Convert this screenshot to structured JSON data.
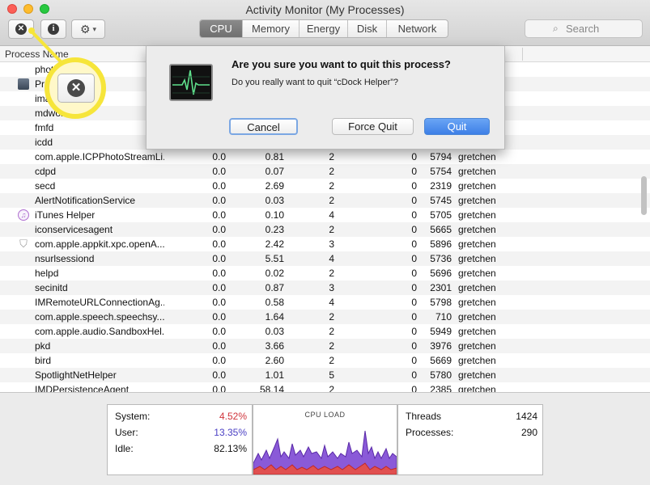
{
  "window": {
    "title": "Activity Monitor (My Processes)"
  },
  "toolbar": {
    "quit_icon": "x-circle-icon",
    "info_icon": "info-icon",
    "gear_icon": "gear-icon",
    "tabs": [
      {
        "label": "CPU",
        "active": true
      },
      {
        "label": "Memory",
        "active": false
      },
      {
        "label": "Energy",
        "active": false
      },
      {
        "label": "Disk",
        "active": false
      },
      {
        "label": "Network",
        "active": false
      }
    ],
    "search_placeholder": "Search"
  },
  "table": {
    "columns": {
      "process_name": "Process Name"
    },
    "rows": [
      {
        "name": "phot",
        "cpu": "",
        "time": "",
        "threads": "",
        "idle": "",
        "pid": "",
        "user": ""
      },
      {
        "name": "Pre",
        "icon": "preview-icon",
        "cpu": "",
        "time": "",
        "threads": "",
        "idle": "",
        "pid": "",
        "user": ""
      },
      {
        "name": "ima",
        "cpu": "",
        "time": "",
        "threads": "",
        "idle": "",
        "pid": "",
        "user": ""
      },
      {
        "name": "mdwor",
        "cpu": "",
        "time": "",
        "threads": "",
        "idle": "",
        "pid": "",
        "user": ""
      },
      {
        "name": "fmfd",
        "cpu": "",
        "time": "",
        "threads": "",
        "idle": "",
        "pid": "",
        "user": ""
      },
      {
        "name": "icdd",
        "cpu": "",
        "time": "",
        "threads": "",
        "idle": "",
        "pid": "",
        "user": ""
      },
      {
        "name": "com.apple.ICPPhotoStreamLi...",
        "cpu": "0.0",
        "time": "0.81",
        "threads": "2",
        "idle": "0",
        "pid": "5794",
        "user": "gretchen"
      },
      {
        "name": "cdpd",
        "cpu": "0.0",
        "time": "0.07",
        "threads": "2",
        "idle": "0",
        "pid": "5754",
        "user": "gretchen"
      },
      {
        "name": "secd",
        "cpu": "0.0",
        "time": "2.69",
        "threads": "2",
        "idle": "0",
        "pid": "2319",
        "user": "gretchen"
      },
      {
        "name": "AlertNotificationService",
        "cpu": "0.0",
        "time": "0.03",
        "threads": "2",
        "idle": "0",
        "pid": "5745",
        "user": "gretchen"
      },
      {
        "name": "iTunes Helper",
        "icon": "itunes-icon",
        "cpu": "0.0",
        "time": "0.10",
        "threads": "4",
        "idle": "0",
        "pid": "5705",
        "user": "gretchen"
      },
      {
        "name": "iconservicesagent",
        "cpu": "0.0",
        "time": "0.23",
        "threads": "2",
        "idle": "0",
        "pid": "5665",
        "user": "gretchen"
      },
      {
        "name": "com.apple.appkit.xpc.openA...",
        "icon": "shield-icon",
        "cpu": "0.0",
        "time": "2.42",
        "threads": "3",
        "idle": "0",
        "pid": "5896",
        "user": "gretchen"
      },
      {
        "name": "nsurlsessiond",
        "cpu": "0.0",
        "time": "5.51",
        "threads": "4",
        "idle": "0",
        "pid": "5736",
        "user": "gretchen"
      },
      {
        "name": "helpd",
        "cpu": "0.0",
        "time": "0.02",
        "threads": "2",
        "idle": "0",
        "pid": "5696",
        "user": "gretchen"
      },
      {
        "name": "secinitd",
        "cpu": "0.0",
        "time": "0.87",
        "threads": "3",
        "idle": "0",
        "pid": "2301",
        "user": "gretchen"
      },
      {
        "name": "IMRemoteURLConnectionAg...",
        "cpu": "0.0",
        "time": "0.58",
        "threads": "4",
        "idle": "0",
        "pid": "5798",
        "user": "gretchen"
      },
      {
        "name": "com.apple.speech.speechsy...",
        "cpu": "0.0",
        "time": "1.64",
        "threads": "2",
        "idle": "0",
        "pid": "710",
        "user": "gretchen"
      },
      {
        "name": "com.apple.audio.SandboxHel...",
        "cpu": "0.0",
        "time": "0.03",
        "threads": "2",
        "idle": "0",
        "pid": "5949",
        "user": "gretchen"
      },
      {
        "name": "pkd",
        "cpu": "0.0",
        "time": "3.66",
        "threads": "2",
        "idle": "0",
        "pid": "3976",
        "user": "gretchen"
      },
      {
        "name": "bird",
        "cpu": "0.0",
        "time": "2.60",
        "threads": "2",
        "idle": "0",
        "pid": "5669",
        "user": "gretchen"
      },
      {
        "name": "SpotlightNetHelper",
        "cpu": "0.0",
        "time": "1.01",
        "threads": "5",
        "idle": "0",
        "pid": "5780",
        "user": "gretchen"
      },
      {
        "name": "IMDPersistenceAgent",
        "cpu": "0.0",
        "time": "58.14",
        "threads": "2",
        "idle": "0",
        "pid": "2385",
        "user": "gretchen"
      }
    ]
  },
  "dialog": {
    "icon": "activity-monitor-icon",
    "title": "Are you sure you want to quit this process?",
    "message": "Do you really want to quit “cDock Helper”?",
    "cancel_label": "Cancel",
    "force_quit_label": "Force Quit",
    "quit_label": "Quit"
  },
  "summary": {
    "system_label": "System:",
    "system_value": "4.52%",
    "system_color": "#d0343b",
    "user_label": "User:",
    "user_value": "13.35%",
    "user_color": "#4a3fc4",
    "idle_label": "Idle:",
    "idle_value": "82.13%",
    "cpu_load_label": "CPU LOAD",
    "threads_label": "Threads",
    "threads_value": "1424",
    "processes_label": "Processes:",
    "processes_value": "290"
  },
  "callout": {
    "icon": "x-circle-icon",
    "color": "#f6e53a"
  }
}
